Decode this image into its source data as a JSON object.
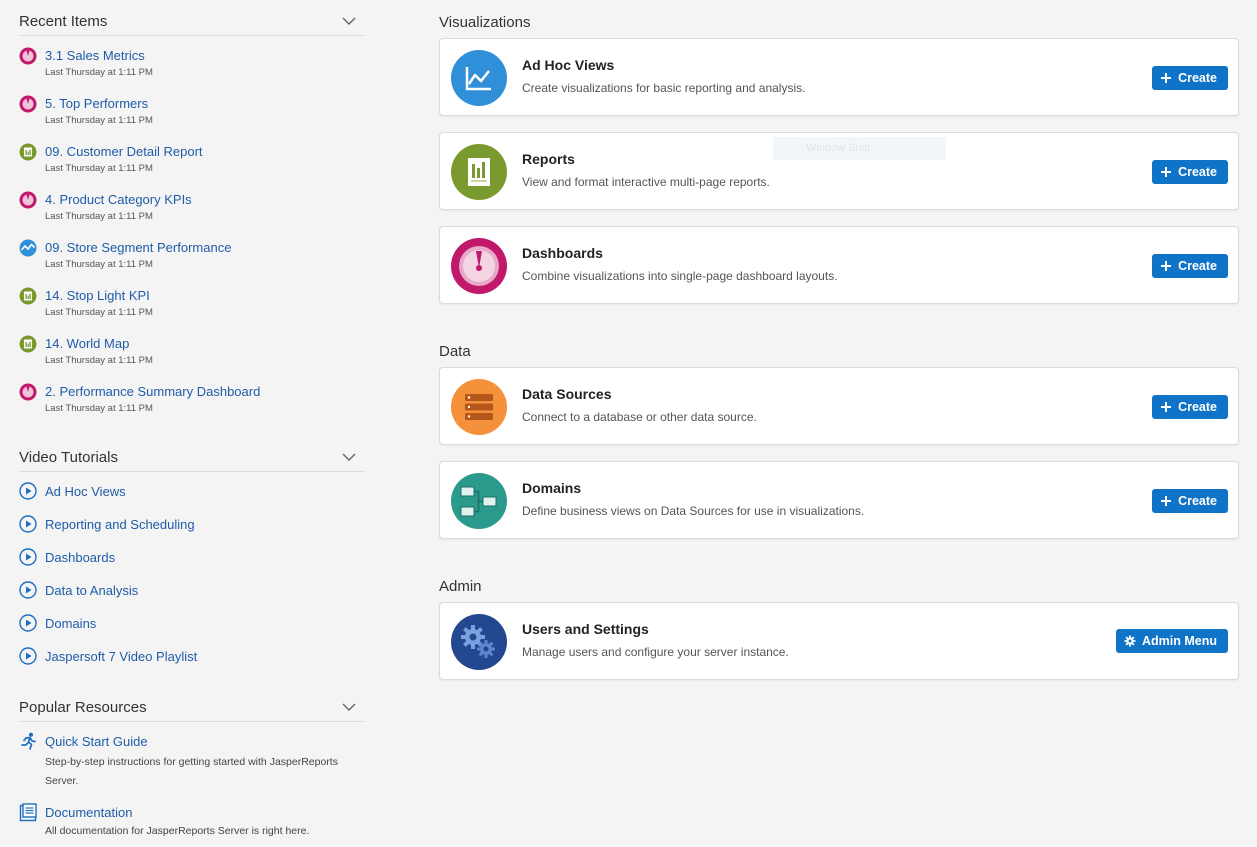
{
  "recent": {
    "title": "Recent Items",
    "items": [
      {
        "name": "3.1 Sales Metrics",
        "time": "Last Thursday at 1:11 PM",
        "type": "dashboard"
      },
      {
        "name": "5. Top Performers",
        "time": "Last Thursday at 1:11 PM",
        "type": "dashboard"
      },
      {
        "name": "09. Customer Detail Report",
        "time": "Last Thursday at 1:11 PM",
        "type": "report"
      },
      {
        "name": "4. Product Category KPIs",
        "time": "Last Thursday at 1:11 PM",
        "type": "dashboard"
      },
      {
        "name": "09. Store Segment Performance",
        "time": "Last Thursday at 1:11 PM",
        "type": "adhoc"
      },
      {
        "name": "14. Stop Light KPI",
        "time": "Last Thursday at 1:11 PM",
        "type": "report"
      },
      {
        "name": "14. World Map",
        "time": "Last Thursday at 1:11 PM",
        "type": "report"
      },
      {
        "name": "2. Performance Summary Dashboard",
        "time": "Last Thursday at 1:11 PM",
        "type": "dashboard"
      }
    ]
  },
  "videos": {
    "title": "Video Tutorials",
    "items": [
      {
        "name": "Ad Hoc Views"
      },
      {
        "name": "Reporting and Scheduling"
      },
      {
        "name": "Dashboards"
      },
      {
        "name": "Data to Analysis"
      },
      {
        "name": "Domains"
      },
      {
        "name": "Jaspersoft 7 Video Playlist"
      }
    ]
  },
  "resources": {
    "title": "Popular Resources",
    "items": [
      {
        "name": "Quick Start Guide",
        "desc": "Step-by-step instructions for getting started with JasperReports Server."
      },
      {
        "name": "Documentation",
        "desc": "All documentation for JasperReports Server is right here."
      }
    ]
  },
  "groups": {
    "visualizations": "Visualizations",
    "data": "Data",
    "admin": "Admin"
  },
  "cards": [
    {
      "title": "Ad Hoc Views",
      "desc": "Create visualizations for basic reporting and analysis.",
      "button": "Create",
      "color": "#2f8fd8"
    },
    {
      "title": "Reports",
      "desc": "View and format interactive multi-page reports.",
      "button": "Create",
      "color": "#7a9a2f"
    },
    {
      "title": "Dashboards",
      "desc": "Combine visualizations into single-page dashboard layouts.",
      "button": "Create",
      "color": "#c2186b"
    },
    {
      "title": "Data Sources",
      "desc": "Connect to a database or other data source.",
      "button": "Create",
      "color": "#f5913b"
    },
    {
      "title": "Domains",
      "desc": "Define business views on Data Sources for use in visualizations.",
      "button": "Create",
      "color": "#2a9a8c"
    },
    {
      "title": "Users and Settings",
      "desc": "Manage users and configure your server instance.",
      "button": "Admin Menu",
      "color": "#24488f"
    }
  ],
  "overlay": {
    "text": "Window Snip"
  },
  "colors": {
    "link": "#1f5ca8",
    "button": "#0f74c8",
    "dashboard": "#c2186b",
    "report": "#7a9a2f",
    "adhoc": "#2f8fd8"
  }
}
